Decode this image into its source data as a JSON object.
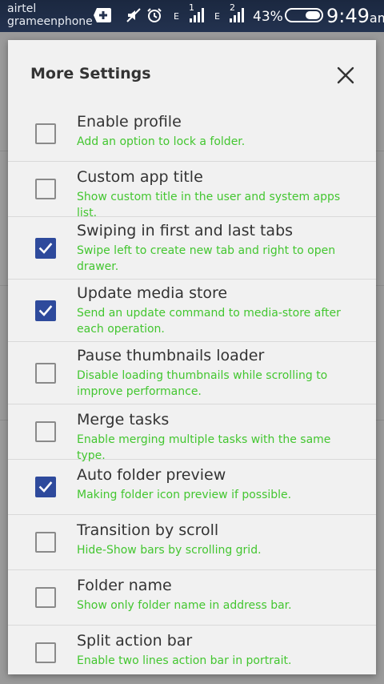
{
  "status_bar": {
    "carrier_1": "airtel",
    "carrier_2": "grameenphone",
    "sim_1_label": "1",
    "sim_2_label": "2",
    "network_type_1": "E",
    "network_type_2": "E",
    "battery_percent": "43%",
    "time": "9:49",
    "time_suffix": "am",
    "icons": [
      "notification-plus-icon",
      "mute-icon",
      "alarm-icon",
      "signal-icon",
      "signal-icon",
      "battery-icon"
    ]
  },
  "dialog": {
    "title": "More Settings",
    "close_icon": "close-icon",
    "accent_color": "#2e4a9c",
    "summary_color": "#43c630",
    "items": [
      {
        "title": "Enable profile",
        "summary": "Add an option to lock a folder.",
        "checked": false
      },
      {
        "title": "Custom app title",
        "summary": "Show custom title in the user and system apps list.",
        "checked": false
      },
      {
        "title": "Swiping in first and last tabs",
        "summary": "Swipe left to create new tab and right to open drawer.",
        "checked": true
      },
      {
        "title": "Update media store",
        "summary": "Send an update command to media-store after each operation.",
        "checked": true
      },
      {
        "title": "Pause thumbnails loader",
        "summary": "Disable loading thumbnails while scrolling to improve performance.",
        "checked": false
      },
      {
        "title": "Merge tasks",
        "summary": "Enable merging multiple tasks with the same type.",
        "checked": false
      },
      {
        "title": "Auto folder preview",
        "summary": "Making folder icon preview if possible.",
        "checked": true
      },
      {
        "title": "Transition by scroll",
        "summary": "Hide-Show bars by scrolling grid.",
        "checked": false
      },
      {
        "title": "Folder name",
        "summary": "Show only folder name in address bar.",
        "checked": false
      },
      {
        "title": "Split action bar",
        "summary": "Enable two lines action bar in portrait.",
        "checked": false
      }
    ]
  }
}
